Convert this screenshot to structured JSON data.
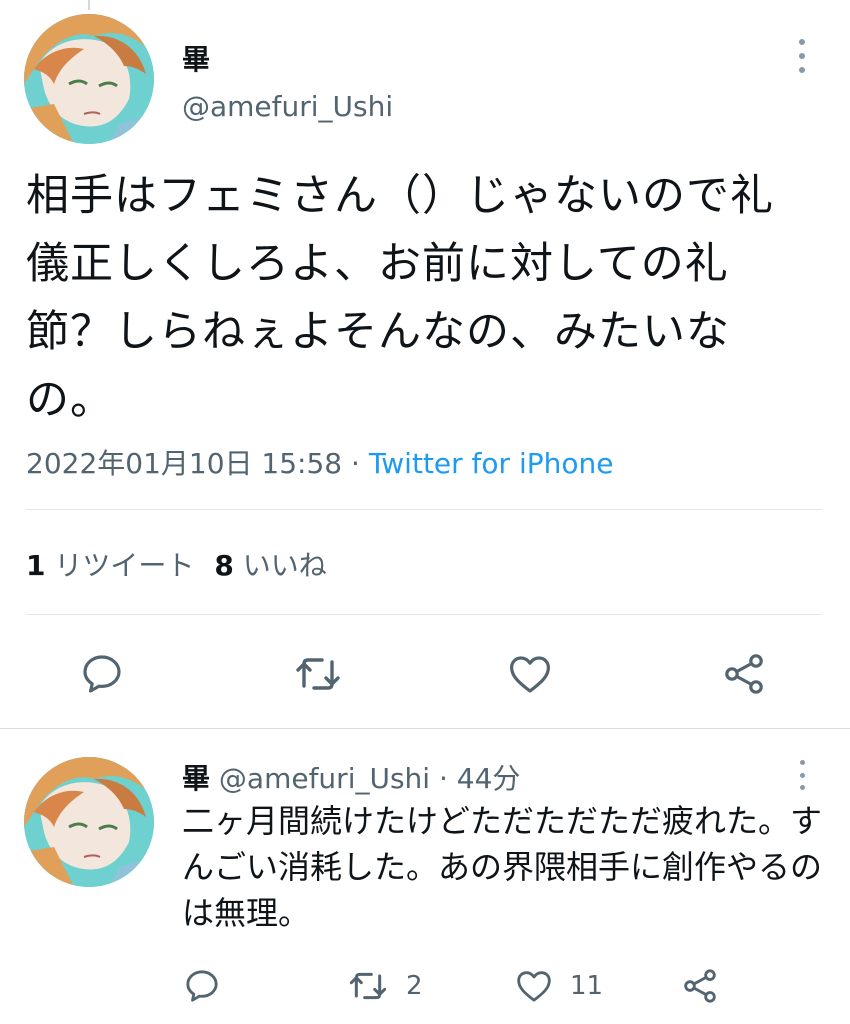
{
  "tweet": {
    "display_name": "畢",
    "handle": "@amefuri_Ushi",
    "text": "相手はフェミさん（）じゃないので礼儀正しくしろよ、お前に対しての礼節？しらねぇよそんなの、みたいなの。",
    "timestamp": "2022年01月10日 15:58",
    "separator": " · ",
    "source": "Twitter for iPhone",
    "retweet_count": "1",
    "retweet_label": "リツイート",
    "like_count": "8",
    "like_label": "いいね",
    "icons": [
      "reply-icon",
      "retweet-icon",
      "like-icon",
      "share-icon",
      "more-icon"
    ]
  },
  "reply": {
    "display_name": "畢",
    "meta": " @amefuri_Ushi · 44分",
    "text": "二ヶ月間続けたけどただただただ疲れた。すんごい消耗した。あの界隈相手に創作やるのは無理。",
    "retweet_count": "2",
    "like_count": "11"
  },
  "colors": {
    "text": "#0f1419",
    "secondary": "#536471",
    "link": "#1d9bf0",
    "divider": "#e1e8ed"
  }
}
